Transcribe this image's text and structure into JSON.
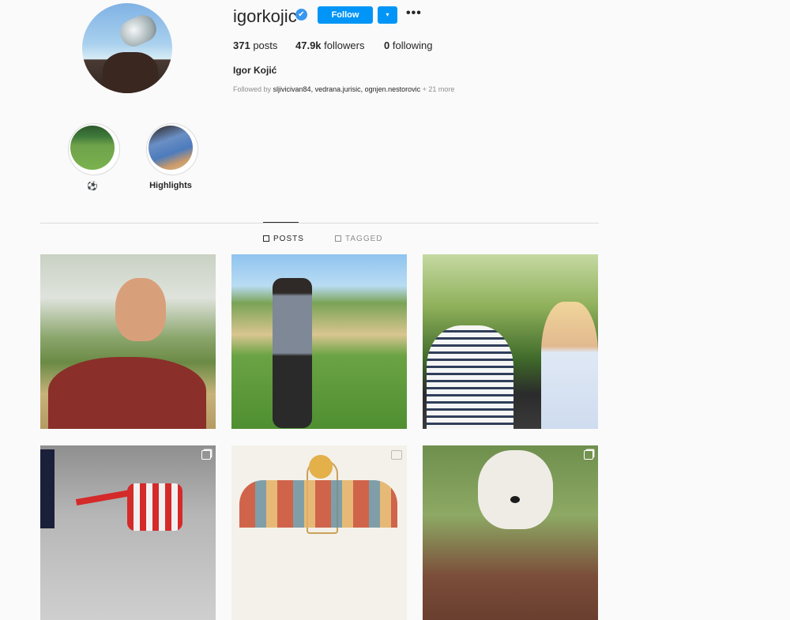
{
  "profile": {
    "username": "igorkojic",
    "verified_icon": "✔",
    "follow_label": "Follow",
    "dropdown_icon": "▾",
    "more_icon": "•••",
    "posts_count": "371",
    "posts_label": "posts",
    "followers_count": "47.9k",
    "followers_label": "followers",
    "following_count": "0",
    "following_label": "following",
    "full_name": "Igor Kojić",
    "followed_by_prefix": "Followed by",
    "followed_by_users": "sljivicivan84, vedrana.jurisic, ognjen.nestorovic",
    "followed_by_more": "+ 21 more"
  },
  "highlights": [
    {
      "label": "⚽"
    },
    {
      "label": "Highlights"
    }
  ],
  "tabs": [
    {
      "label": "POSTS",
      "icon": "grid-icon"
    },
    {
      "label": "TAGGED",
      "icon": "tag-icon"
    }
  ],
  "colors": {
    "accent": "#0095f6",
    "verified": "#3897f0"
  }
}
